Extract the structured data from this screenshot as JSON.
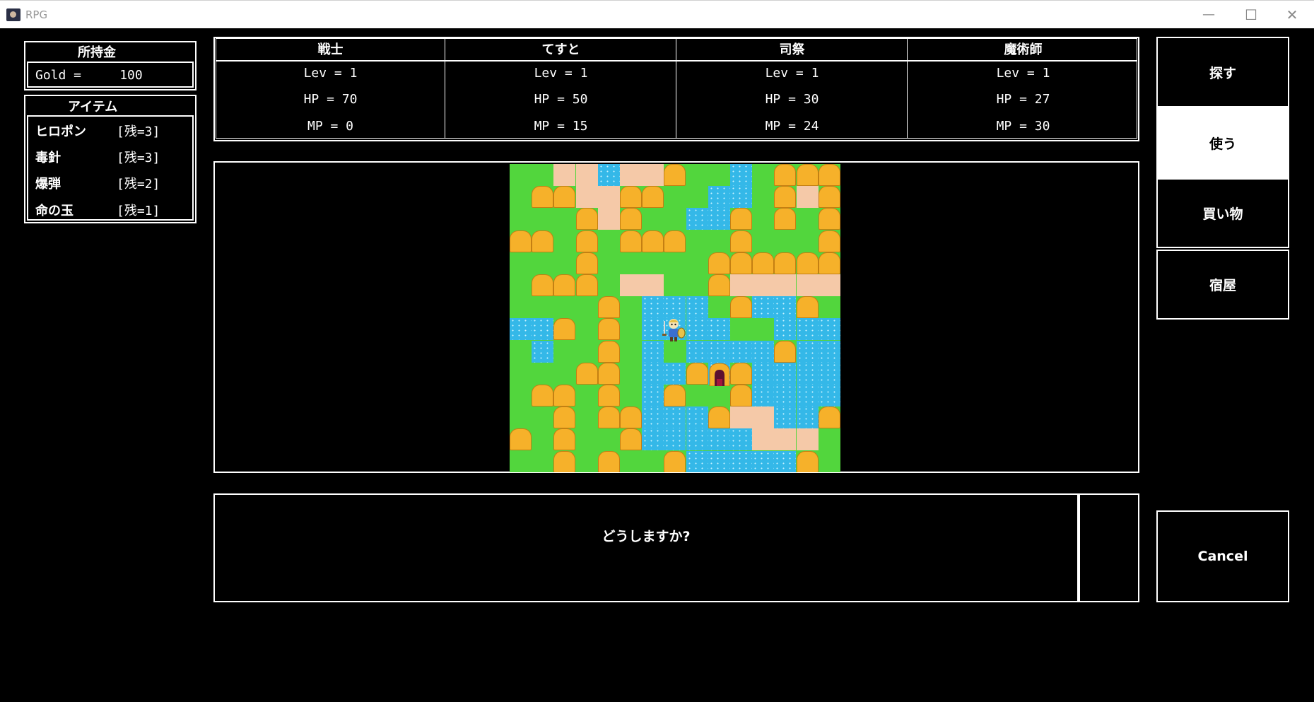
{
  "window": {
    "title": "RPG",
    "controls": {
      "minimize": "—",
      "maximize": "☐",
      "close": "✕"
    }
  },
  "gold": {
    "title": "所持金",
    "text": "Gold =     100"
  },
  "items": {
    "title": "アイテム",
    "list": [
      {
        "name": "ヒロポン",
        "count": "[残=3]"
      },
      {
        "name": "毒針",
        "count": "[残=3]"
      },
      {
        "name": "爆弾",
        "count": "[残=2]"
      },
      {
        "name": "命の玉",
        "count": "[残=1]"
      }
    ]
  },
  "party": [
    {
      "name": "戦士",
      "lev": "Lev = 1",
      "hp": "HP = 70",
      "mp": "MP = 0"
    },
    {
      "name": "てすと",
      "lev": "Lev = 1",
      "hp": "HP = 50",
      "mp": "MP = 15"
    },
    {
      "name": "司祭",
      "lev": "Lev = 1",
      "hp": "HP = 30",
      "mp": "MP = 24"
    },
    {
      "name": "魔術師",
      "lev": "Lev = 1",
      "hp": "HP = 27",
      "mp": "MP = 30"
    }
  ],
  "commands": {
    "search": "探す",
    "use": "使う",
    "shop": "買い物",
    "inn": "宿屋",
    "cancel": "Cancel",
    "selected": "use"
  },
  "message": {
    "text": "どうしますか?"
  },
  "colors": {
    "background": "#000000",
    "grass": "#52d63d",
    "rock": "#f6b12a",
    "sand": "#f5c9a8",
    "water": "#34b8e8",
    "selected_button": "#ffffff"
  },
  "map": {
    "rows": [
      "..SSWSS#..W.###",
      ".##SS##..WW.#S#",
      "...#S#..WW#.#.#",
      "##.#.###..#...#",
      "...#.....######",
      ".###.SS..#SSSSS",
      "....#.WWW.#WW#.",
      "WW#.#.WHWW..WWW",
      ".W..#.W.WWWW#WW",
      "...##.WW#C#WWWW",
      ".##.#.W#..#WWWW",
      "..#.##WWW#SSWW#",
      "#.#..#WWWWWSSS.",
      "..#.#..#WWWWW#."
    ]
  }
}
